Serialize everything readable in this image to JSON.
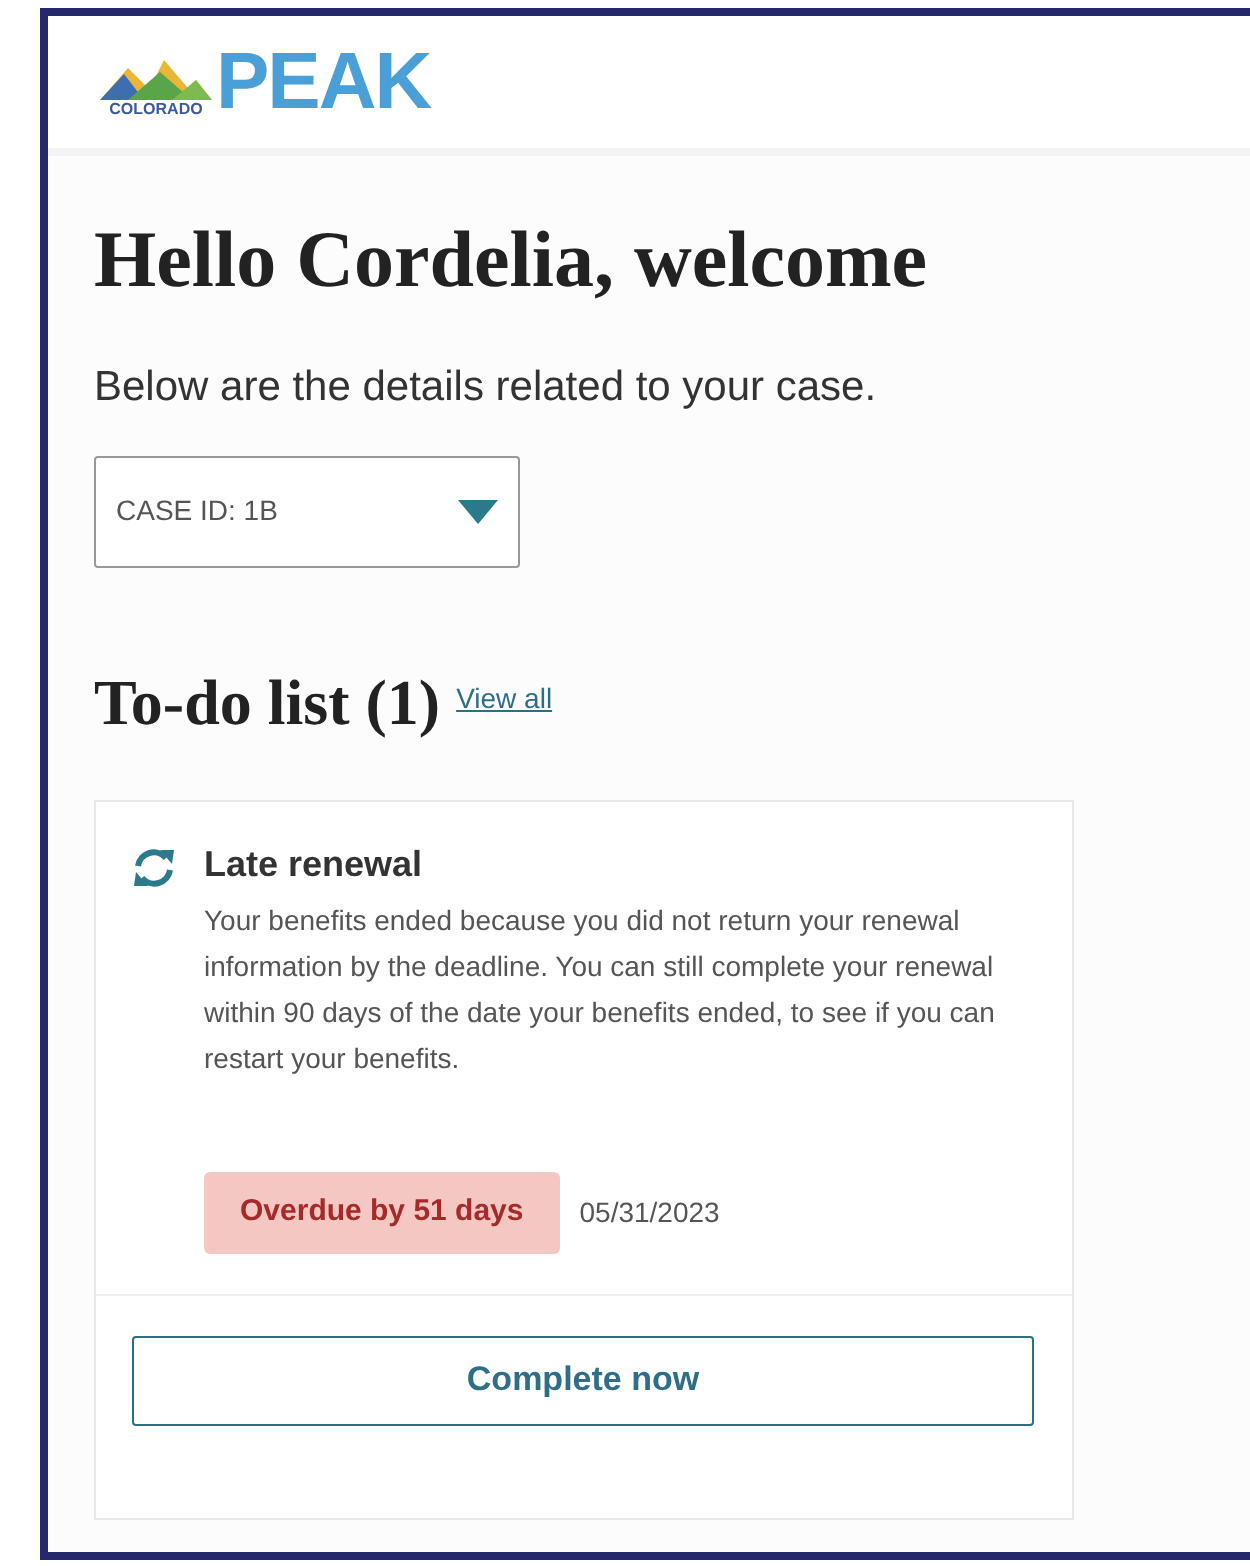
{
  "logo": {
    "state_text": "COLORADO",
    "brand_text": "PEAK"
  },
  "greeting": "Hello Cordelia, welcome",
  "intro": "Below are the details related to your case.",
  "case_select": {
    "value": "CASE ID: 1B"
  },
  "todo": {
    "title": "To-do list (1)",
    "view_all": "View all",
    "items": [
      {
        "title": "Late renewal",
        "description": "Your benefits ended because you did not return your renewal information by the deadline. You can still complete your renewal within 90 days of the date your benefits ended, to see if you can restart your benefits.",
        "status": "Overdue by 51 days",
        "overdue": true,
        "date": "05/31/2023",
        "action": "Complete now"
      }
    ]
  }
}
